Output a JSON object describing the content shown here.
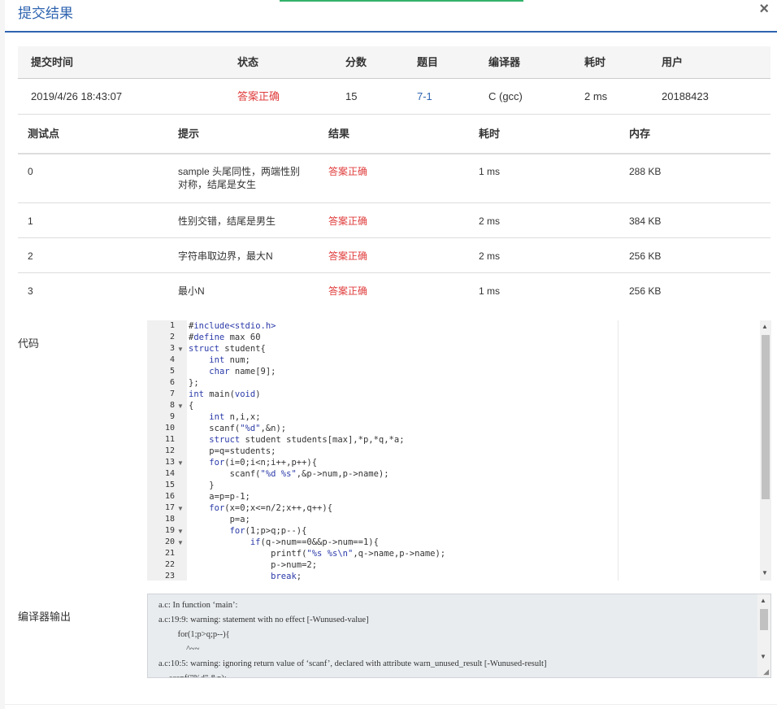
{
  "modal": {
    "title": "提交结果",
    "close": "×"
  },
  "summary": {
    "headers": [
      "提交时间",
      "状态",
      "分数",
      "题目",
      "编译器",
      "耗时",
      "用户"
    ],
    "row": {
      "time": "2019/4/26 18:43:07",
      "status": "答案正确",
      "score": "15",
      "problem": "7-1",
      "compiler": "C (gcc)",
      "elapsed": "2 ms",
      "user": "20188423"
    }
  },
  "testcases": {
    "headers": [
      "测试点",
      "提示",
      "结果",
      "耗时",
      "内存"
    ],
    "rows": [
      {
        "id": "0",
        "hint_line1": "sample 头尾同性，两端性别",
        "hint_line2": "对称，结尾是女生",
        "result": "答案正确",
        "time": "1 ms",
        "memory": "288 KB"
      },
      {
        "id": "1",
        "hint_line1": "性别交错，结尾是男生",
        "hint_line2": "",
        "result": "答案正确",
        "time": "2 ms",
        "memory": "384 KB"
      },
      {
        "id": "2",
        "hint_line1": "字符串取边界，最大N",
        "hint_line2": "",
        "result": "答案正确",
        "time": "2 ms",
        "memory": "256 KB"
      },
      {
        "id": "3",
        "hint_line1": "最小N",
        "hint_line2": "",
        "result": "答案正确",
        "time": "1 ms",
        "memory": "256 KB"
      }
    ]
  },
  "code_label": "代码",
  "code_lines": [
    "#include<stdio.h>",
    "#define max 60",
    "struct student{",
    "    int num;",
    "    char name[9];",
    "};",
    "int main(void)",
    "{",
    "    int n,i,x;",
    "    scanf(\"%d\",&n);",
    "    struct student students[max],*p,*q,*a;",
    "    p=q=students;",
    "    for(i=0;i<n;i++,p++){",
    "        scanf(\"%d %s\",&p->num,p->name);",
    "    }",
    "    a=p=p-1;",
    "    for(x=0;x<=n/2;x++,q++){",
    "        p=a;",
    "        for(1;p>q;p--){",
    "            if(q->num==0&&p->num==1){",
    "                printf(\"%s %s\\n\",q->name,p->name);",
    "                p->num=2;",
    "                break;"
  ],
  "compiler_label": "编译器输出",
  "compiler_output": [
    "a.c: In function ‘main’:",
    "a.c:19:9: warning: statement with no effect [-Wunused-value]",
    "         for(1;p>q;p--){",
    "             ^~~",
    "a.c:10:5: warning: ignoring return value of ‘scanf’, declared with attribute warn_unused_result [-Wunused-result]",
    "     scanf(\"%d\",&n);"
  ]
}
